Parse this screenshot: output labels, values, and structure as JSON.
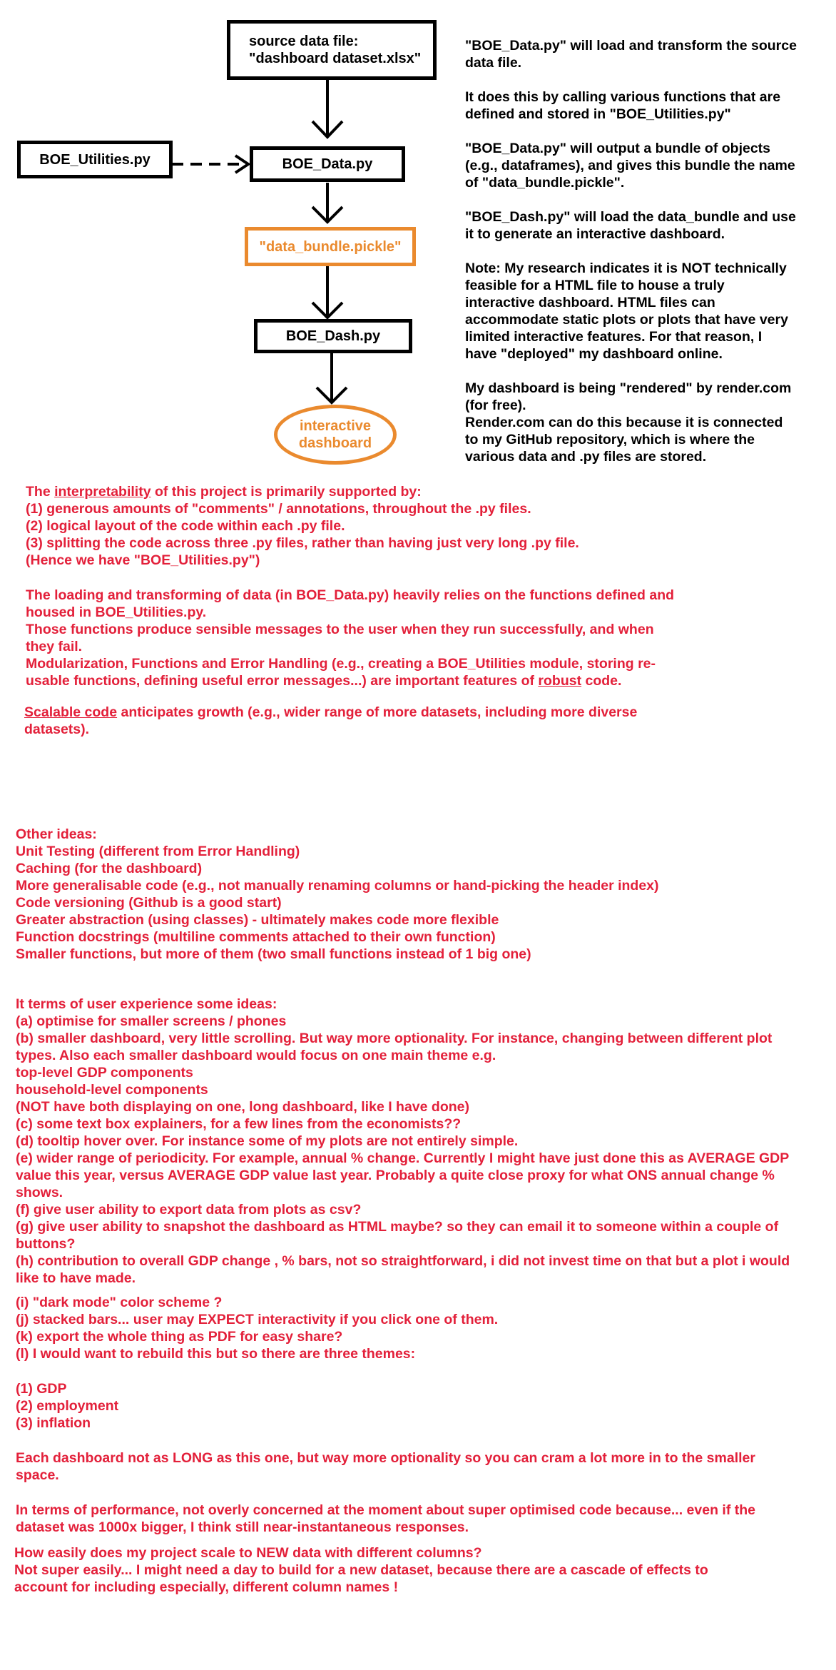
{
  "diagram": {
    "nodes": {
      "source": "source data file:\n\"dashboard dataset.xlsx\"",
      "utilities": "BOE_Utilities.py",
      "data": "BOE_Data.py",
      "pickle": "\"data_bundle.pickle\"",
      "dash": "BOE_Dash.py",
      "dashboard": "interactive\ndashboard"
    },
    "colors": {
      "node_border": "#000000",
      "highlight": "#ea8a2e",
      "notes": "#e3203a"
    }
  },
  "explanation": [
    [
      "\"BOE_Data.py\" will load and transform the source",
      "data file."
    ],
    [
      "It does this by calling various functions that are",
      "defined and stored in \"BOE_Utilities.py\""
    ],
    [
      "\"BOE_Data.py\" will output a bundle of objects",
      "(e.g., dataframes), and gives this bundle the name",
      "of \"data_bundle.pickle\"."
    ],
    [
      "\"BOE_Dash.py\" will load the data_bundle and use",
      "it to generate an interactive dashboard."
    ],
    [
      "Note: My research indicates it is NOT technically",
      "feasible for a HTML file to house a truly",
      "interactive dashboard. HTML files can",
      "accommodate static plots or plots that have very",
      "limited interactive features. For that reason, I",
      "have \"deployed\" my dashboard online."
    ],
    [
      "My dashboard is being \"rendered\" by render.com",
      "(for free).",
      "Render.com can do this because it is connected",
      "to my GitHub repository, which is where the",
      "various data and .py files are stored."
    ]
  ],
  "interpretability": {
    "prefix": "The ",
    "term": "interpretability",
    "suffix": " of this project is primarily supported by:",
    "lines": [
      "(1) generous amounts of \"comments\" / annotations, throughout the .py files.",
      "(2) logical layout of the code within each .py file.",
      "(3) splitting the code across three .py files, rather than having just very long .py file.",
      "(Hence we have \"BOE_Utilities.py\")"
    ]
  },
  "robust": {
    "lines": [
      "The loading and transforming of data (in BOE_Data.py) heavily relies on the functions defined and",
      "housed in BOE_Utilities.py.",
      "Those functions produce sensible messages to the user when they run successfully, and when",
      "they fail.",
      "Modularization, Functions and Error Handling (e.g., creating a BOE_Utilities module, storing re-"
    ],
    "last_prefix": "usable functions, defining useful error messages...) are important features of ",
    "last_term": "robust",
    "last_suffix": " code."
  },
  "scalable": {
    "term": "Scalable code",
    "suffix": " anticipates growth (e.g., wider range of more datasets, including more diverse",
    "line2": "datasets)."
  },
  "other_ideas": [
    "Other ideas:",
    "Unit Testing (different from Error Handling)",
    "Caching (for the dashboard)",
    "More generalisable code (e.g., not manually renaming columns or hand-picking the header index)",
    "Code versioning (Github is a good start)",
    "Greater abstraction (using classes) - ultimately makes code more flexible",
    "Function docstrings (multiline comments attached to their own function)",
    "Smaller functions, but more of them (two small functions instead of 1 big one)"
  ],
  "ux_ideas": [
    "It terms of user experience some ideas:",
    "(a) optimise for smaller screens / phones",
    "(b) smaller dashboard, very little scrolling. But way more optionality. For instance, changing between different plot",
    "types. Also each smaller dashboard would focus on one main theme e.g.",
    "top-level GDP components",
    "household-level components",
    "(NOT have both displaying on one, long dashboard, like I have done)",
    "(c) some text box explainers, for a few lines from the economists??",
    "(d) tooltip hover over. For instance some of my plots are not entirely simple.",
    "(e) wider range of periodicity. For example, annual % change. Currently I might have just done this as AVERAGE GDP",
    "value this year, versus AVERAGE GDP value last year. Probably a quite close proxy for what ONS annual change %",
    "shows.",
    "(f) give user ability to export data from plots as csv?",
    "(g) give user ability to snapshot the dashboard as HTML maybe? so they can email it to someone within a couple of",
    "buttons?",
    "(h) contribution to overall GDP change , % bars, not so straightforward, i did not invest time on that but a plot i would",
    "like to have made."
  ],
  "more_ideas": [
    "(i) \"dark mode\" color scheme ?",
    "(j) stacked bars... user may EXPECT interactivity if you click one of them.",
    "(k) export the whole thing as PDF for easy share?",
    "(l) I would want to rebuild this but so there are three themes:"
  ],
  "themes": [
    "(1) GDP",
    "(2) employment",
    "(3) inflation"
  ],
  "each_dashboard": [
    "Each dashboard not as LONG as this one, but way more optionality so you can cram a lot more in to the smaller",
    "space."
  ],
  "performance": [
    "In terms of performance, not overly concerned at the moment about super optimised code because... even if the",
    "dataset was 1000x bigger, I think still near-instantaneous responses."
  ],
  "new_data": [
    "How easily does my project scale to NEW data with different columns?",
    "Not super easily... I might need a day to build for a new dataset, because there are a cascade of effects to",
    "account for including especially, different column names !"
  ]
}
